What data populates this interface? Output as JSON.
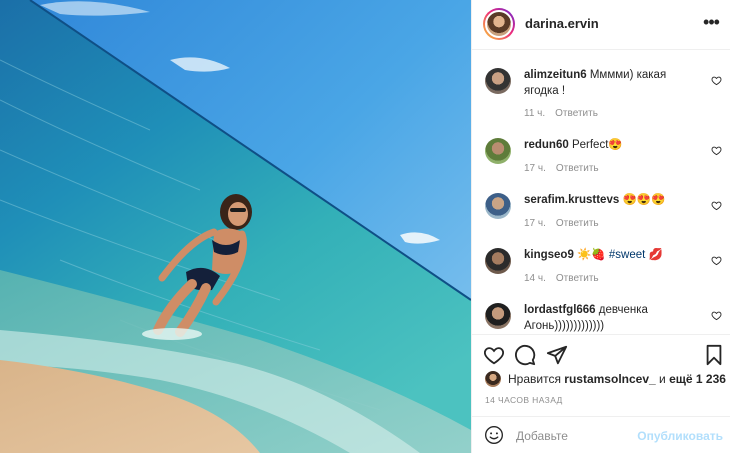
{
  "post": {
    "username": "darina.ervin",
    "more_icon": "ellipsis-icon"
  },
  "comments": [
    {
      "user": "alimzeitun6",
      "text": "Мммми) какая ягодка !",
      "time": "11 ч.",
      "reply": "Ответить"
    },
    {
      "user": "redun60",
      "text": "Perfect😍",
      "time": "17 ч.",
      "reply": "Ответить"
    },
    {
      "user": "serafim.krusttevs",
      "text": "😍😍😍",
      "time": "17 ч.",
      "reply": "Ответить"
    },
    {
      "user": "kingseo9",
      "text_before": "☀️🍓 ",
      "hashtag": "#sweet",
      "text_after": " 💋",
      "time": "14 ч.",
      "reply": "Ответить"
    },
    {
      "user": "lordastfgl666",
      "text": "девченка Агонь)))))))))))))"
    }
  ],
  "actions": {
    "like_icon": "heart-icon",
    "comment_icon": "comment-icon",
    "share_icon": "share-icon",
    "save_icon": "bookmark-icon"
  },
  "likes": {
    "prefix": "Нравится",
    "user": "rustamsolncev_",
    "middle": "и",
    "more": "ещё 1 236"
  },
  "time_ago": "14 ЧАСОВ НАЗАД",
  "add_comment": {
    "placeholder": "Добавьте",
    "publish": "Опубликовать"
  },
  "colors": {
    "accent_blue": "#0095f6",
    "publish_disabled": "#b2dffc",
    "hashtag": "#00376b",
    "muted": "#8e8e8e"
  }
}
